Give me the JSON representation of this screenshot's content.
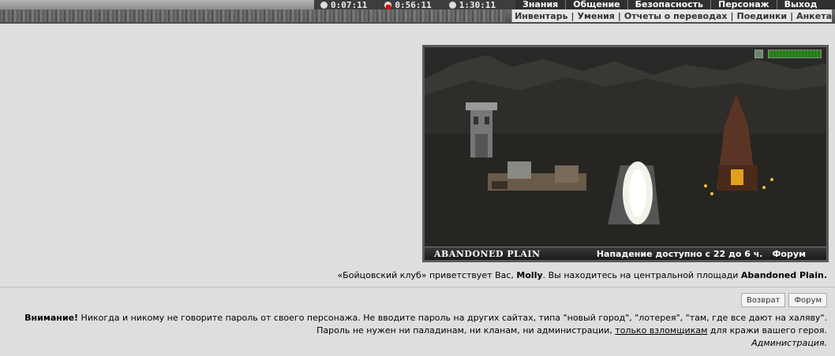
{
  "timers": [
    {
      "icon": "clock-icon",
      "value": "0:07:11"
    },
    {
      "icon": "red-clock-icon",
      "value": "0:56:11"
    },
    {
      "icon": "clock-icon",
      "value": "1:30:11"
    }
  ],
  "main_menu": [
    "Знания",
    "Общение",
    "Безопасность",
    "Персонаж",
    "Выход"
  ],
  "sub_menu": [
    "Инвентарь",
    "Умения",
    "Отчеты о переводах",
    "Поединки",
    "Анкета"
  ],
  "scene": {
    "location_name": "ABANDONED PLAIN",
    "attack_info": "Нападение доступно с 22 до 6 ч.",
    "forum_label": "Форум",
    "hp_fraction": 1.0
  },
  "welcome": {
    "prefix": "«Бойцовский клуб» приветствует Вас, ",
    "name": "Molly",
    "middle": ". Вы находитесь на центральной площади ",
    "place": "Abandoned Plain."
  },
  "buttons": {
    "back": "Возврат",
    "forum": "Форум"
  },
  "warning": {
    "bold": "Внимание!",
    "line1": " Никогда и никому не говорите пароль от своего персонажа. Не вводите пароль на других сайтах, типа \"новый город\", \"лотерея\", \"там, где все дают на халяву\".",
    "line2_a": "Пароль не нужен ни паладинам, ни кланам, ни администрации, ",
    "line2_u": "только взломщикам",
    "line2_b": " для кражи вашего героя.",
    "signature": "Администрация."
  }
}
